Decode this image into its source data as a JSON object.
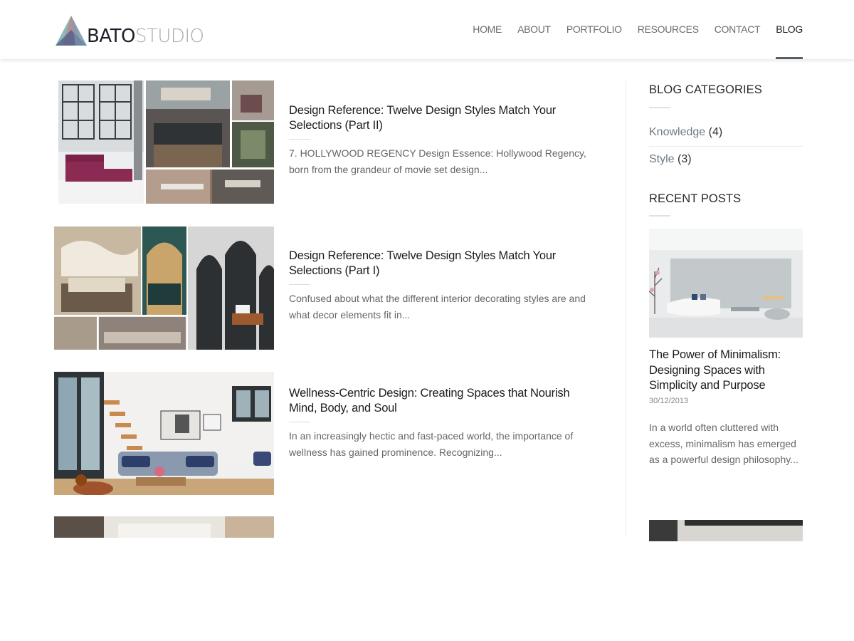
{
  "site": {
    "logo_part1": "BATO",
    "logo_part2": "STUDIO"
  },
  "nav": {
    "items": [
      {
        "label": "HOME"
      },
      {
        "label": "ABOUT"
      },
      {
        "label": "PORTFOLIO"
      },
      {
        "label": "RESOURCES"
      },
      {
        "label": "CONTACT"
      },
      {
        "label": "BLOG",
        "active": true
      }
    ]
  },
  "posts": [
    {
      "title": "Design Reference: Twelve Design Styles Match Your Selections (Part II)",
      "excerpt": "7. HOLLYWOOD REGENCY Design Essence: Hollywood Regency, born from the grandeur of movie set design..."
    },
    {
      "title": "Design Reference: Twelve Design Styles Match Your Selections (Part I)",
      "excerpt": "Confused about what the different interior decorating styles are and what decor elements fit in..."
    },
    {
      "title": "Wellness-Centric Design: Creating Spaces that Nourish Mind, Body, and Soul",
      "excerpt": "In an increasingly hectic and fast-paced world, the importance of wellness has gained prominence. Recognizing..."
    }
  ],
  "sidebar": {
    "categories_heading": "BLOG CATEGORIES",
    "categories": [
      {
        "name": "Knowledge",
        "count": "(4)"
      },
      {
        "name": "Style",
        "count": "(3)"
      }
    ],
    "recent_heading": "RECENT POSTS",
    "recent_post": {
      "title": "The Power of Minimalism: Designing Spaces with Simplicity and Purpose",
      "date": "30/12/2013",
      "excerpt": "In a world often cluttered with excess, minimalism has emerged as a powerful design philosophy..."
    }
  },
  "colors": {
    "accent": "#555f66",
    "category_link": "#6d7a86",
    "logo_dark": "#1f1f28",
    "logo_light": "#a9aaaa"
  }
}
